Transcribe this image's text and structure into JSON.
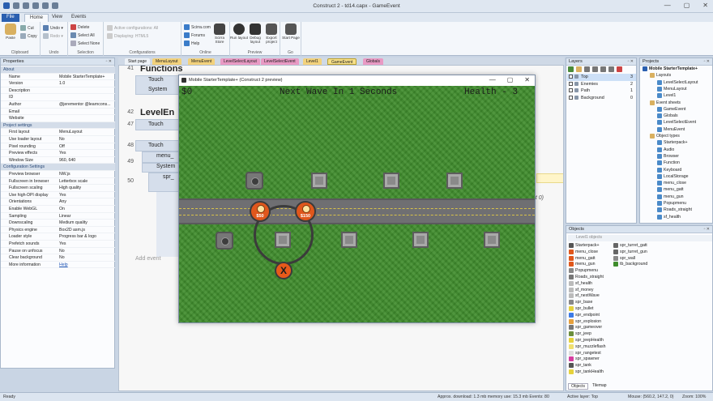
{
  "app": {
    "title": "Construct 2 - td14.capx - GameEvent",
    "window_controls": [
      "—",
      "▢",
      "✕"
    ]
  },
  "ribbon_tabs": {
    "file": "File",
    "home": "Home",
    "view": "View",
    "events": "Events"
  },
  "ribbon": {
    "clipboard": {
      "paste": "Paste",
      "cut": "Cut",
      "copy": "Copy",
      "label": "Clipboard"
    },
    "undo": {
      "undo": "Undo ▾",
      "redo": "Redo ▾",
      "label": "Undo"
    },
    "selection": {
      "delete": "Delete",
      "select_all": "Select All",
      "select_none": "Select None",
      "label": "Selection"
    },
    "configurations": {
      "active": "Active configurations: All",
      "displaying": "Displaying: HTML5",
      "label": "Configurations"
    },
    "online": {
      "scirra": "Scirra.com",
      "forums": "Forums",
      "help": "Help",
      "store": "Scirra Store",
      "label": "Online"
    },
    "preview": {
      "run": "Run layout",
      "debug": "Debug layout",
      "export": "Export project",
      "label": "Preview"
    },
    "go": {
      "start": "Start Page",
      "label": "Go"
    }
  },
  "properties": {
    "title": "Properties",
    "rows": [
      {
        "k": "About",
        "v": "",
        "cat": true
      },
      {
        "k": "Name",
        "v": "Mobile StarterTemplate+"
      },
      {
        "k": "Version",
        "v": "1.0"
      },
      {
        "k": "Description",
        "v": ""
      },
      {
        "k": "ID",
        "v": ""
      },
      {
        "k": "Author",
        "v": "@jerementor @learncons..."
      },
      {
        "k": "Email",
        "v": ""
      },
      {
        "k": "Website",
        "v": ""
      },
      {
        "k": "Project settings",
        "v": "",
        "cat": true
      },
      {
        "k": "First layout",
        "v": "MenuLayout"
      },
      {
        "k": "Use loader layout",
        "v": "No"
      },
      {
        "k": "Pixel rounding",
        "v": "Off"
      },
      {
        "k": "Preview effects",
        "v": "Yes"
      },
      {
        "k": "Window Size",
        "v": "960, 640"
      },
      {
        "k": "Configuration Settings",
        "v": "",
        "cat": true
      },
      {
        "k": "Preview browser",
        "v": "NW.js"
      },
      {
        "k": "Fullscreen in browser",
        "v": "Letterbox scale"
      },
      {
        "k": "Fullscreen scaling",
        "v": "High quality"
      },
      {
        "k": "Use high-DPI display",
        "v": "Yes"
      },
      {
        "k": "Orientations",
        "v": "Any"
      },
      {
        "k": "Enable WebGL",
        "v": "On"
      },
      {
        "k": "Sampling",
        "v": "Linear"
      },
      {
        "k": "Downscaling",
        "v": "Medium quality"
      },
      {
        "k": "Physics engine",
        "v": "Box2D asm.js"
      },
      {
        "k": "Loader style",
        "v": "Progress bar & logo"
      },
      {
        "k": "Prefetch sounds",
        "v": "Yes"
      },
      {
        "k": "Pause on unfocus",
        "v": "No"
      },
      {
        "k": "Clear background",
        "v": "No"
      },
      {
        "k": "More information",
        "v": "Help",
        "link": true
      }
    ]
  },
  "doc_tabs": [
    "Start page",
    "MenuLayout",
    "MenuEvent",
    "LevelSelectLayout",
    "LevelSelectEvent",
    "Level1",
    "GameEvent",
    "Globals"
  ],
  "events": {
    "n41": "41",
    "functions": "Functions",
    "touch1": "Touch",
    "system1": "System",
    "n42": "42",
    "levelend": "LevelEn",
    "n47": "47",
    "touch2": "Touch",
    "n48": "48",
    "touch3": "Touch",
    "menu": "menu_",
    "n49": "49",
    "system2": "System",
    "spr": "spr_",
    "n50": "50",
    "add_event": "Add event",
    "trailing": "nt 0)"
  },
  "preview": {
    "title": "Mobile StarterTemplate+ (Construct 2 preview)",
    "hud_money": "$0",
    "hud_wave": "Next Wave In 1 Seconds",
    "hud_health": "Health - 3",
    "btn1_price": "$50",
    "btn2_price": "$150",
    "close_label": "X"
  },
  "layers": {
    "title": "Layers",
    "rows": [
      {
        "n": "Top",
        "c": "3",
        "sel": true
      },
      {
        "n": "Enemies",
        "c": "2"
      },
      {
        "n": "Path",
        "c": "1"
      },
      {
        "n": "Background",
        "c": "0"
      }
    ]
  },
  "projects": {
    "title": "Projects",
    "rows": [
      {
        "t": "Mobile StarterTemplate+",
        "d": 0,
        "bold": true
      },
      {
        "t": "Layouts",
        "d": 1
      },
      {
        "t": "LevelSelectLayout",
        "d": 2
      },
      {
        "t": "MenuLayout",
        "d": 2
      },
      {
        "t": "Level1",
        "d": 2
      },
      {
        "t": "Event sheets",
        "d": 1
      },
      {
        "t": "GameEvent",
        "d": 2
      },
      {
        "t": "Globals",
        "d": 2
      },
      {
        "t": "LevelSelectEvent",
        "d": 2
      },
      {
        "t": "MenuEvent",
        "d": 2
      },
      {
        "t": "Object types",
        "d": 1
      },
      {
        "t": "Starterpack+",
        "d": 2
      },
      {
        "t": "Audio",
        "d": 2
      },
      {
        "t": "Browser",
        "d": 2
      },
      {
        "t": "Function",
        "d": 2
      },
      {
        "t": "Keyboard",
        "d": 2
      },
      {
        "t": "LocalStorage",
        "d": 2
      },
      {
        "t": "menu_close",
        "d": 2
      },
      {
        "t": "menu_gatt",
        "d": 2
      },
      {
        "t": "menu_gun",
        "d": 2
      },
      {
        "t": "Popupmenu",
        "d": 2
      },
      {
        "t": "Roads_straight",
        "d": 2
      },
      {
        "t": "sf_health",
        "d": 2
      }
    ]
  },
  "objects": {
    "title": "Objects",
    "header": "Level1 objects",
    "col1": [
      {
        "t": "Starterpack+",
        "c": "#555555"
      },
      {
        "t": "menu_close",
        "c": "#e0571c"
      },
      {
        "t": "menu_gatt",
        "c": "#e0571c"
      },
      {
        "t": "menu_gun",
        "c": "#e0571c"
      },
      {
        "t": "Popupmenu",
        "c": "#888888"
      },
      {
        "t": "Roads_straight",
        "c": "#777777"
      },
      {
        "t": "sf_health",
        "c": "#bbbbbb"
      },
      {
        "t": "sf_money",
        "c": "#bbbbbb"
      },
      {
        "t": "sf_nextWave",
        "c": "#bbbbbb"
      },
      {
        "t": "spr_base",
        "c": "#888888"
      },
      {
        "t": "spr_bullet",
        "c": "#e6d23c"
      },
      {
        "t": "spr_endpoint",
        "c": "#3c7ae6"
      },
      {
        "t": "spr_explosion",
        "c": "#e6a03c"
      },
      {
        "t": "spr_gameover",
        "c": "#777777"
      },
      {
        "t": "spr_jeep",
        "c": "#6b8e3c"
      },
      {
        "t": "spr_jeepHealth",
        "c": "#e6d23c"
      },
      {
        "t": "spr_muzzleflash",
        "c": "#f0e070"
      },
      {
        "t": "spr_rangetest",
        "c": "#dddddd"
      },
      {
        "t": "spr_spawner",
        "c": "#d63ca0"
      },
      {
        "t": "spr_tank",
        "c": "#555555"
      },
      {
        "t": "spr_tankHealth",
        "c": "#e6d23c"
      }
    ],
    "col2": [
      {
        "t": "spr_turret_gatt",
        "c": "#666666"
      },
      {
        "t": "spr_turret_gun",
        "c": "#666666"
      },
      {
        "t": "spr_wall",
        "c": "#888888"
      },
      {
        "t": "tb_background",
        "c": "#3f8c2c"
      }
    ],
    "tabs": [
      "Objects",
      "Tilemap"
    ]
  },
  "statusbar": {
    "ready": "Ready",
    "download": "Approx. download: 1.3 mb  memory use: 15.3 mb  Events: 80",
    "layer": "Active layer: Top",
    "mouse": "Mouse: (560.2, 147.2, 0)",
    "zoom": "Zoom: 100%"
  }
}
